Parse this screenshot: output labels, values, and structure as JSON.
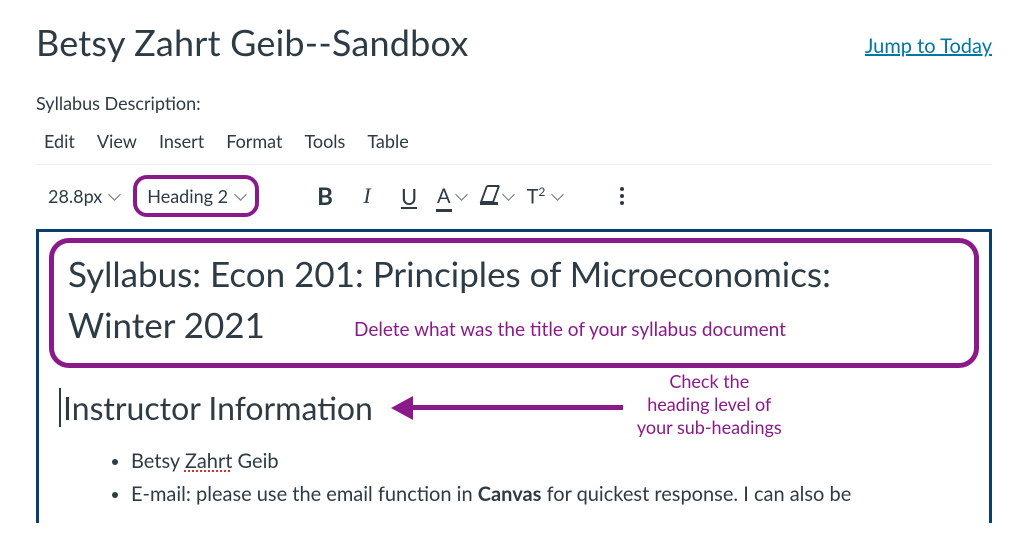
{
  "header": {
    "title": "Betsy Zahrt Geib--Sandbox",
    "jump_link": "Jump to Today"
  },
  "editor": {
    "description_label": "Syllabus Description:",
    "menu": [
      "Edit",
      "View",
      "Insert",
      "Format",
      "Tools",
      "Table"
    ],
    "toolbar": {
      "font_size": "28.8px",
      "heading_select": "Heading 2",
      "superscript_label": "T²"
    }
  },
  "content": {
    "h1_line1": "Syllabus: Econ 201: Principles of Microeconomics:",
    "h1_line2": "Winter 2021",
    "h2": "Instructor Information",
    "bullets": {
      "b1_pre": "Betsy ",
      "b1_mid": "Zahrt",
      "b1_post": " Geib",
      "b2_pre": "E-mail: please use the email function in ",
      "b2_bold": "Canvas",
      "b2_post": " for quickest response. I can also be"
    }
  },
  "annotations": {
    "a1": "Delete what was the title of your syllabus document",
    "a2_l1": "Check the",
    "a2_l2": "heading level of",
    "a2_l3": "your sub-headings"
  }
}
